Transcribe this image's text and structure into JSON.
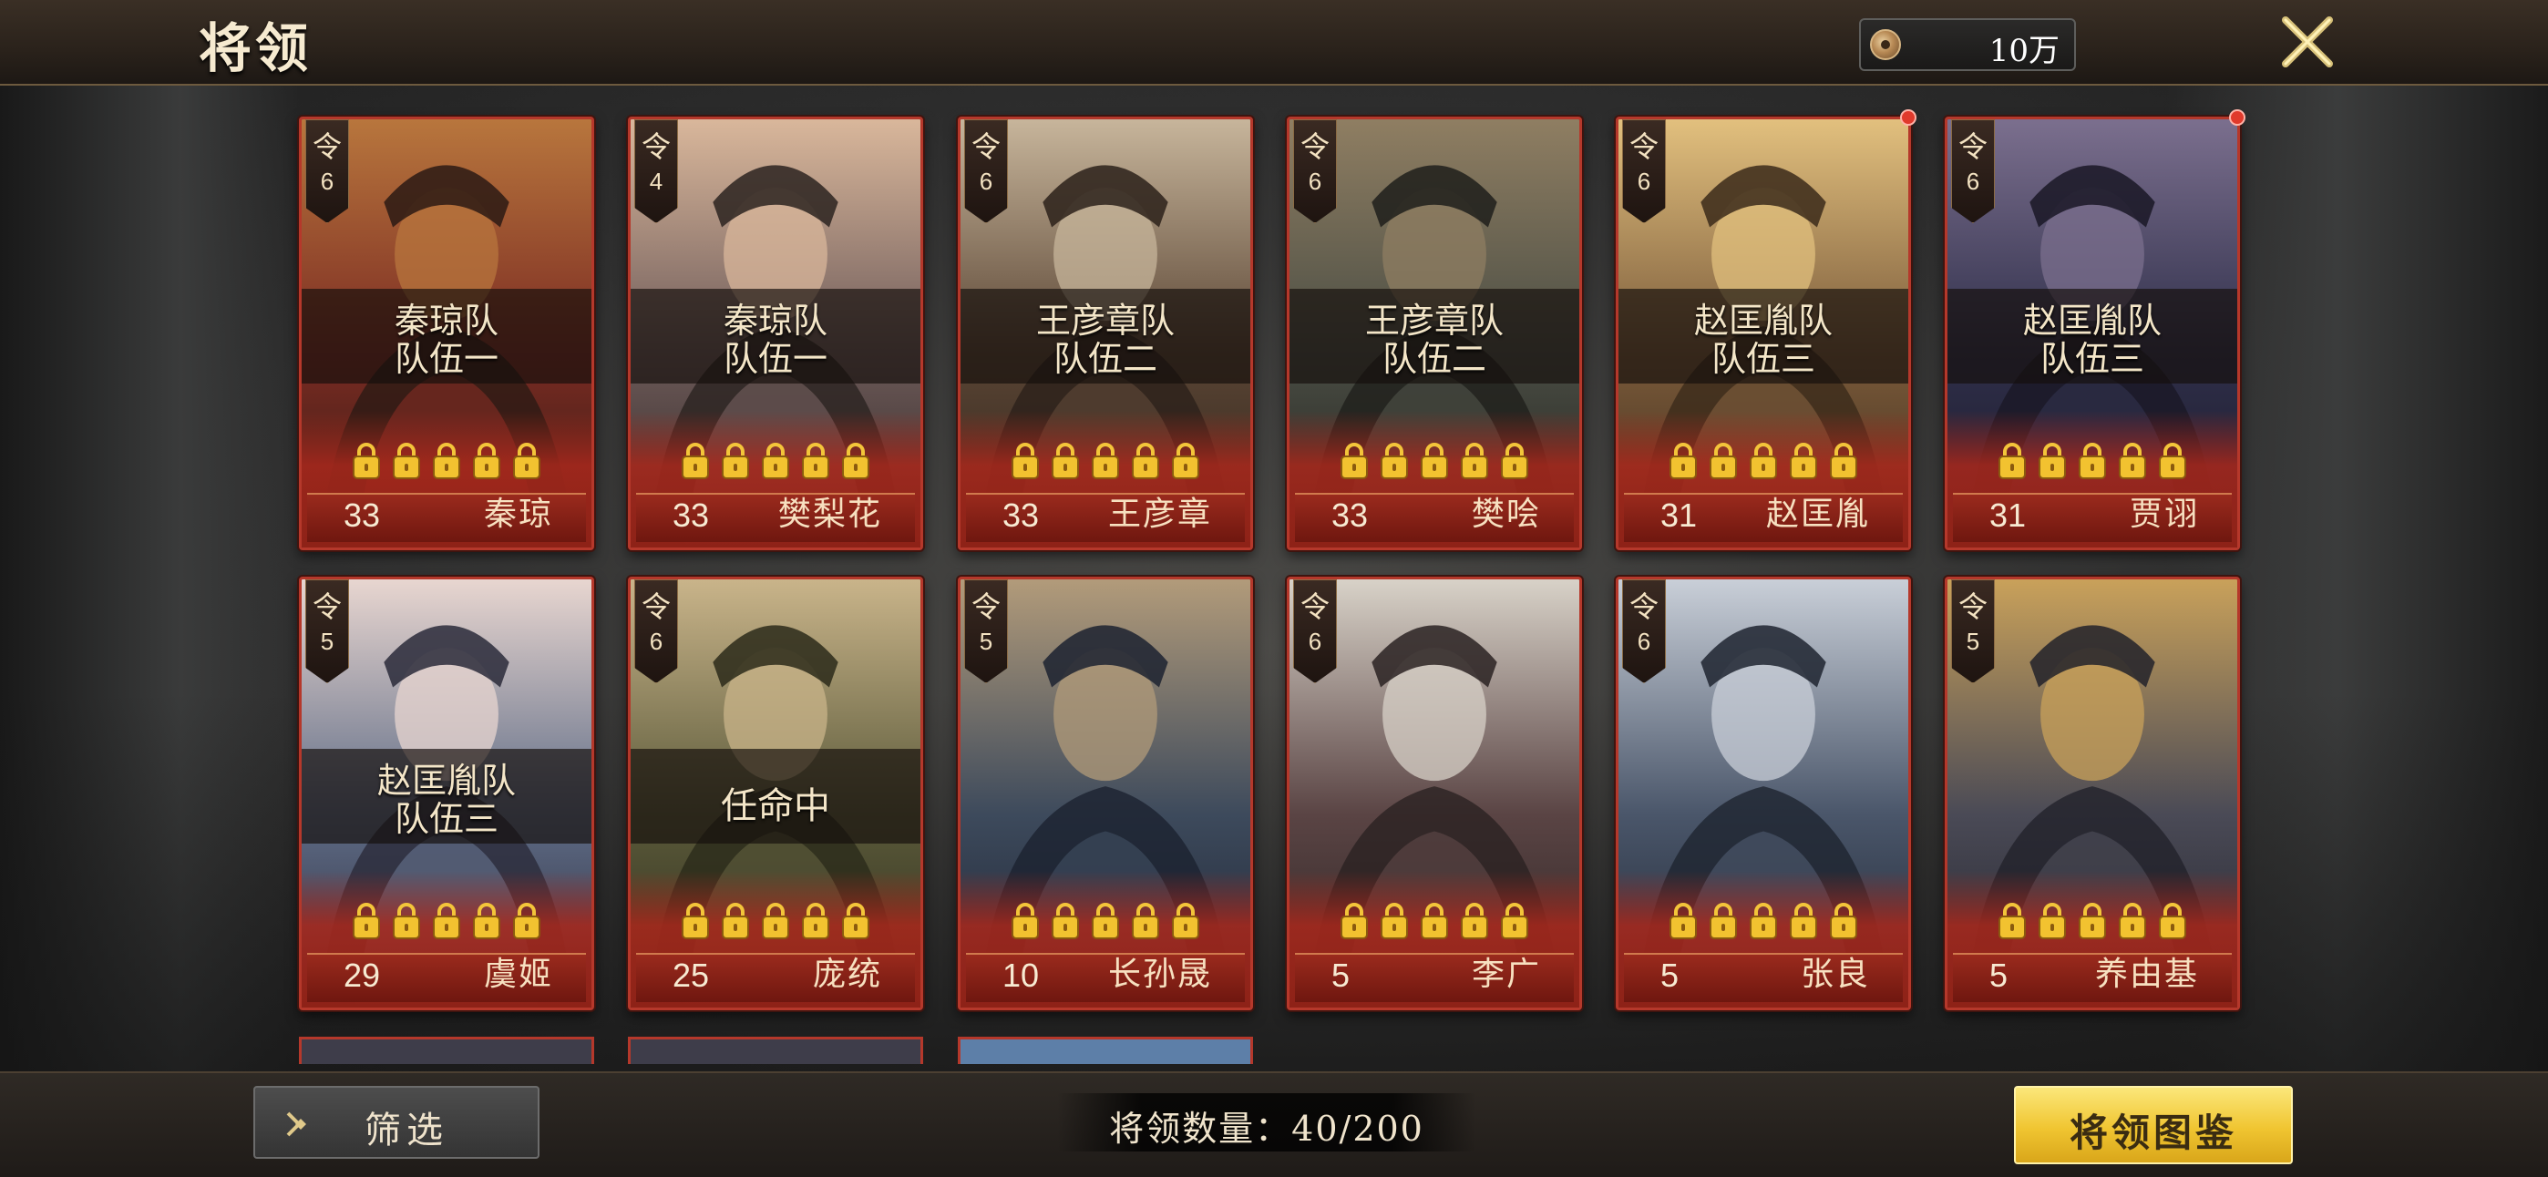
{
  "header": {
    "title": "将领",
    "currency": {
      "icon": "coin-icon",
      "value": "10万"
    },
    "close_icon": "close-icon"
  },
  "generals": [
    {
      "rank_label": "令",
      "rank": "6",
      "team_line1": "秦琼队",
      "team_line2": "队伍一",
      "level": "33",
      "name": "秦琼",
      "locks": 5,
      "has_notification": false
    },
    {
      "rank_label": "令",
      "rank": "4",
      "team_line1": "秦琼队",
      "team_line2": "队伍一",
      "level": "33",
      "name": "樊梨花",
      "locks": 5,
      "has_notification": false
    },
    {
      "rank_label": "令",
      "rank": "6",
      "team_line1": "王彦章队",
      "team_line2": "队伍二",
      "level": "33",
      "name": "王彦章",
      "locks": 5,
      "has_notification": false
    },
    {
      "rank_label": "令",
      "rank": "6",
      "team_line1": "王彦章队",
      "team_line2": "队伍二",
      "level": "33",
      "name": "樊哙",
      "locks": 5,
      "has_notification": false
    },
    {
      "rank_label": "令",
      "rank": "6",
      "team_line1": "赵匡胤队",
      "team_line2": "队伍三",
      "level": "31",
      "name": "赵匡胤",
      "locks": 5,
      "has_notification": true
    },
    {
      "rank_label": "令",
      "rank": "6",
      "team_line1": "赵匡胤队",
      "team_line2": "队伍三",
      "level": "31",
      "name": "贾诩",
      "locks": 5,
      "has_notification": true
    },
    {
      "rank_label": "令",
      "rank": "5",
      "team_line1": "赵匡胤队",
      "team_line2": "队伍三",
      "level": "29",
      "name": "虞姬",
      "locks": 5,
      "has_notification": false
    },
    {
      "rank_label": "令",
      "rank": "6",
      "status": "任命中",
      "level": "25",
      "name": "庞统",
      "locks": 5,
      "has_notification": false
    },
    {
      "rank_label": "令",
      "rank": "5",
      "level": "10",
      "name": "长孙晟",
      "locks": 5,
      "has_notification": false
    },
    {
      "rank_label": "令",
      "rank": "6",
      "level": "5",
      "name": "李广",
      "locks": 5,
      "has_notification": false
    },
    {
      "rank_label": "令",
      "rank": "6",
      "level": "5",
      "name": "张良",
      "locks": 5,
      "has_notification": false
    },
    {
      "rank_label": "令",
      "rank": "5",
      "level": "5",
      "name": "养由基",
      "locks": 5,
      "has_notification": false
    }
  ],
  "card_palettes": [
    [
      "#7b2b22",
      "#b8763d",
      "#2c1a14"
    ],
    [
      "#6d5a59",
      "#d9b79b",
      "#2b2320"
    ],
    [
      "#5a4534",
      "#c7b59b",
      "#2c211a"
    ],
    [
      "#4a4d44",
      "#8f7e62",
      "#1f1f1b"
    ],
    [
      "#7a5a3a",
      "#e2c07e",
      "#3b2a1a"
    ],
    [
      "#2f2f4a",
      "#7b6f8e",
      "#1a1826"
    ],
    [
      "#5f6c86",
      "#e8d6d0",
      "#2a2a3a"
    ],
    [
      "#5b5a3a",
      "#c9b48a",
      "#2b2a1a"
    ],
    [
      "#3d4a5c",
      "#b29b7a",
      "#1c2230"
    ],
    [
      "#5a4444",
      "#d8d2c8",
      "#2a2222"
    ],
    [
      "#4a566a",
      "#c9cfd8",
      "#1e2430"
    ],
    [
      "#4a4a56",
      "#c9a15a",
      "#22222a"
    ]
  ],
  "bottom": {
    "filter_label": "筛选",
    "count_text": "将领数量：40/200",
    "archive_label": "将领图鉴"
  }
}
